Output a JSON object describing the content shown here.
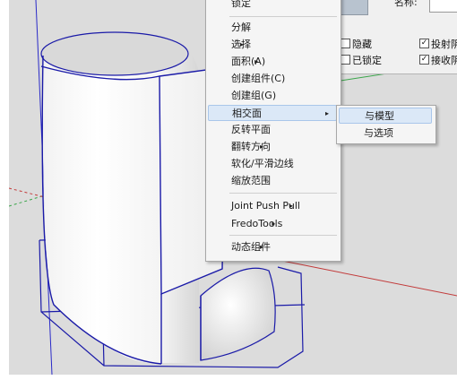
{
  "context_menu": {
    "top_item": "锁定",
    "items": [
      {
        "label": "分解",
        "submenu": false
      },
      {
        "label": "选择",
        "submenu": true
      },
      {
        "label": "面积(A)",
        "submenu": true
      },
      {
        "label": "创建组件(C)",
        "submenu": false
      },
      {
        "label": "创建组(G)",
        "submenu": false
      },
      {
        "label": "相交面",
        "submenu": true,
        "active": true
      },
      {
        "label": "反转平面",
        "submenu": false
      },
      {
        "label": "翻转方向",
        "submenu": true
      },
      {
        "label": "软化/平滑边线",
        "submenu": false
      },
      {
        "label": "缩放范围",
        "submenu": false
      },
      {
        "label": "Joint Push Pull",
        "submenu": true
      },
      {
        "label": "FredoTools",
        "submenu": true
      },
      {
        "label": "动态组件",
        "submenu": true
      }
    ],
    "arrow_glyph": "▸"
  },
  "submenu": {
    "items": [
      {
        "label": "与模型",
        "highlighted": true
      },
      {
        "label": "与选项",
        "highlighted": false
      }
    ]
  },
  "entity_panel": {
    "name_label": "名称:",
    "hidden_label": "隐藏",
    "locked_label": "已锁定",
    "cast_shadow_label": "投射阴",
    "receive_shadow_label": "接收阴",
    "hidden_checked": false,
    "locked_checked": false,
    "cast_shadow_checked": true,
    "receive_shadow_checked": true,
    "check_glyph": "✓"
  },
  "colors": {
    "selection_edge": "#1a1aa8",
    "viewport_bg": "#dcdcdc",
    "menu_bg": "#f5f5f5",
    "menu_highlight": "#dbe8f7",
    "axis_red": "#c23a3a",
    "axis_green": "#3aa64a"
  }
}
